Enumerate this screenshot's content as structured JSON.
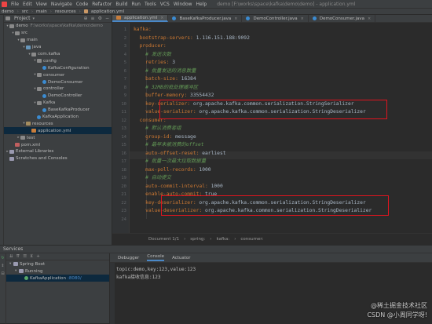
{
  "menubar": {
    "items": [
      "File",
      "Edit",
      "View",
      "Navigate",
      "Code",
      "Refactor",
      "Build",
      "Run",
      "Tools",
      "VCS",
      "Window",
      "Help"
    ],
    "window_title": "demo [F:\\works\\space\\kafka\\demo\\demo] - application.yml"
  },
  "navbar": {
    "crumbs": [
      "demo",
      "src",
      "main",
      "resources",
      "application.yml"
    ]
  },
  "project": {
    "title": "Project",
    "tree": [
      {
        "indent": 0,
        "arrow": "▾",
        "icon": "folder",
        "label": "demo",
        "muted": "F:\\works\\space\\kafka\\demo\\demo"
      },
      {
        "indent": 1,
        "arrow": "▾",
        "icon": "folder",
        "label": "src",
        "muted": ""
      },
      {
        "indent": 2,
        "arrow": "▾",
        "icon": "folder",
        "label": "main",
        "muted": ""
      },
      {
        "indent": 3,
        "arrow": "▾",
        "icon": "src",
        "label": "java",
        "muted": ""
      },
      {
        "indent": 4,
        "arrow": "▾",
        "icon": "folder",
        "label": "com.kafka",
        "muted": ""
      },
      {
        "indent": 5,
        "arrow": "▾",
        "icon": "folder",
        "label": "config",
        "muted": ""
      },
      {
        "indent": 6,
        "arrow": "",
        "icon": "class",
        "label": "KafkaConfiguration",
        "muted": ""
      },
      {
        "indent": 5,
        "arrow": "▾",
        "icon": "folder",
        "label": "consumer",
        "muted": ""
      },
      {
        "indent": 6,
        "arrow": "",
        "icon": "class",
        "label": "DemoConsumer",
        "muted": ""
      },
      {
        "indent": 5,
        "arrow": "▾",
        "icon": "folder",
        "label": "controller",
        "muted": ""
      },
      {
        "indent": 6,
        "arrow": "",
        "icon": "class",
        "label": "DemoController",
        "muted": ""
      },
      {
        "indent": 5,
        "arrow": "▾",
        "icon": "folder",
        "label": "Kafka",
        "muted": ""
      },
      {
        "indent": 6,
        "arrow": "",
        "icon": "class",
        "label": "BaseKafkaProducer",
        "muted": ""
      },
      {
        "indent": 5,
        "arrow": "",
        "icon": "class",
        "label": "KafkaApplication",
        "muted": ""
      },
      {
        "indent": 3,
        "arrow": "▾",
        "icon": "res",
        "label": "resources",
        "muted": ""
      },
      {
        "indent": 4,
        "arrow": "",
        "icon": "yml",
        "label": "application.yml",
        "muted": "",
        "selected": true
      },
      {
        "indent": 2,
        "arrow": "▸",
        "icon": "folder",
        "label": "test",
        "muted": ""
      },
      {
        "indent": 1,
        "arrow": "",
        "icon": "xml",
        "label": "pom.xml",
        "muted": ""
      },
      {
        "indent": 0,
        "arrow": "▸",
        "icon": "lib",
        "label": "External Libraries",
        "muted": ""
      },
      {
        "indent": 0,
        "arrow": "",
        "icon": "lib",
        "label": "Scratches and Consoles",
        "muted": ""
      }
    ]
  },
  "tabs": [
    {
      "label": "application.yml",
      "icon": "yml",
      "active": true
    },
    {
      "label": "BaseKafkaProducer.java",
      "icon": "class",
      "active": false
    },
    {
      "label": "DemoController.java",
      "icon": "class",
      "active": false
    },
    {
      "label": "DemoConsumer.java",
      "icon": "class",
      "active": false
    }
  ],
  "editor": {
    "lines": [
      {
        "n": "1",
        "key": "kafka:",
        "val": "",
        "cls": "k"
      },
      {
        "n": "2",
        "key": "  bootstrap-servers:",
        "val": " 1.116.151.188:9092",
        "cls": "k"
      },
      {
        "n": "3",
        "key": "  producer:",
        "val": "",
        "cls": "k"
      },
      {
        "n": "4",
        "key": "    # 发送次数",
        "val": "",
        "cls": "c"
      },
      {
        "n": "5",
        "key": "    retries:",
        "val": " 3",
        "cls": "k"
      },
      {
        "n": "6",
        "key": "    # 批量发送的消息数量",
        "val": "",
        "cls": "c"
      },
      {
        "n": "7",
        "key": "    batch-size:",
        "val": " 16384",
        "cls": "k"
      },
      {
        "n": "8",
        "key": "    # 32MB的批处理缓冲区",
        "val": "",
        "cls": "c"
      },
      {
        "n": "9",
        "key": "    buffer-memory:",
        "val": " 33554432",
        "cls": "k"
      },
      {
        "n": "10",
        "key": "    key-serializer:",
        "val": " org.apache.kafka.common.serialization.StringSerializer",
        "cls": "k"
      },
      {
        "n": "11",
        "key": "    value-serializer:",
        "val": " org.apache.kafka.common.serialization.StringDeserializer",
        "cls": "k"
      },
      {
        "n": "12",
        "key": "  consumer:",
        "val": "",
        "cls": "k"
      },
      {
        "n": "13",
        "key": "    # 默认消费者组",
        "val": "",
        "cls": "c"
      },
      {
        "n": "14",
        "key": "    group-id:",
        "val": " message",
        "cls": "k"
      },
      {
        "n": "15",
        "key": "    # 最早未被消费的offset",
        "val": "",
        "cls": "c"
      },
      {
        "n": "16",
        "key": "    auto-offset-reset:",
        "val": " earliest",
        "cls": "k"
      },
      {
        "n": "17",
        "key": "    # 批量一次最大拉取数据量",
        "val": "",
        "cls": "c"
      },
      {
        "n": "18",
        "key": "    max-poll-records:",
        "val": " 1000",
        "cls": "k"
      },
      {
        "n": "19",
        "key": "    # 自动提交",
        "val": "",
        "cls": "c"
      },
      {
        "n": "20",
        "key": "    auto-commit-interval:",
        "val": " 1000",
        "cls": "k"
      },
      {
        "n": "21",
        "key": "    enable-auto-commit:",
        "val": " true",
        "cls": "k"
      },
      {
        "n": "22",
        "key": "    key-deserializer:",
        "val": " org.apache.kafka.common.serialization.StringDeserializer",
        "cls": "k"
      },
      {
        "n": "23",
        "key": "    value-deserializer:",
        "val": " org.apache.kafka.common.serialization.StringDeserializer",
        "cls": "k"
      },
      {
        "n": "24",
        "key": "",
        "val": "",
        "cls": "k"
      }
    ]
  },
  "breadcrumb": {
    "items": [
      "Document 1/1",
      "spring:",
      "kafka:",
      "consumer:"
    ]
  },
  "services": {
    "title": "Services",
    "tree": [
      {
        "arrow": "▾",
        "label": "Spring Boot",
        "run": false
      },
      {
        "arrow": "▾",
        "label": "Running",
        "run": false
      },
      {
        "arrow": "",
        "label": "KafkaApplication",
        "run": true,
        "port": ":8080/",
        "selected": true
      }
    ]
  },
  "console_tabs": [
    {
      "label": "Debugger",
      "active": false
    },
    {
      "label": "Console",
      "active": true
    },
    {
      "label": "Actuator",
      "active": false
    }
  ],
  "console": {
    "lines": [
      "topic:demo,key:123,value:123",
      "kafka接收信息:123"
    ]
  },
  "watermark": {
    "line1": "@稀土掘金技术社区",
    "line2": "CSDN @小周同学呀!"
  }
}
